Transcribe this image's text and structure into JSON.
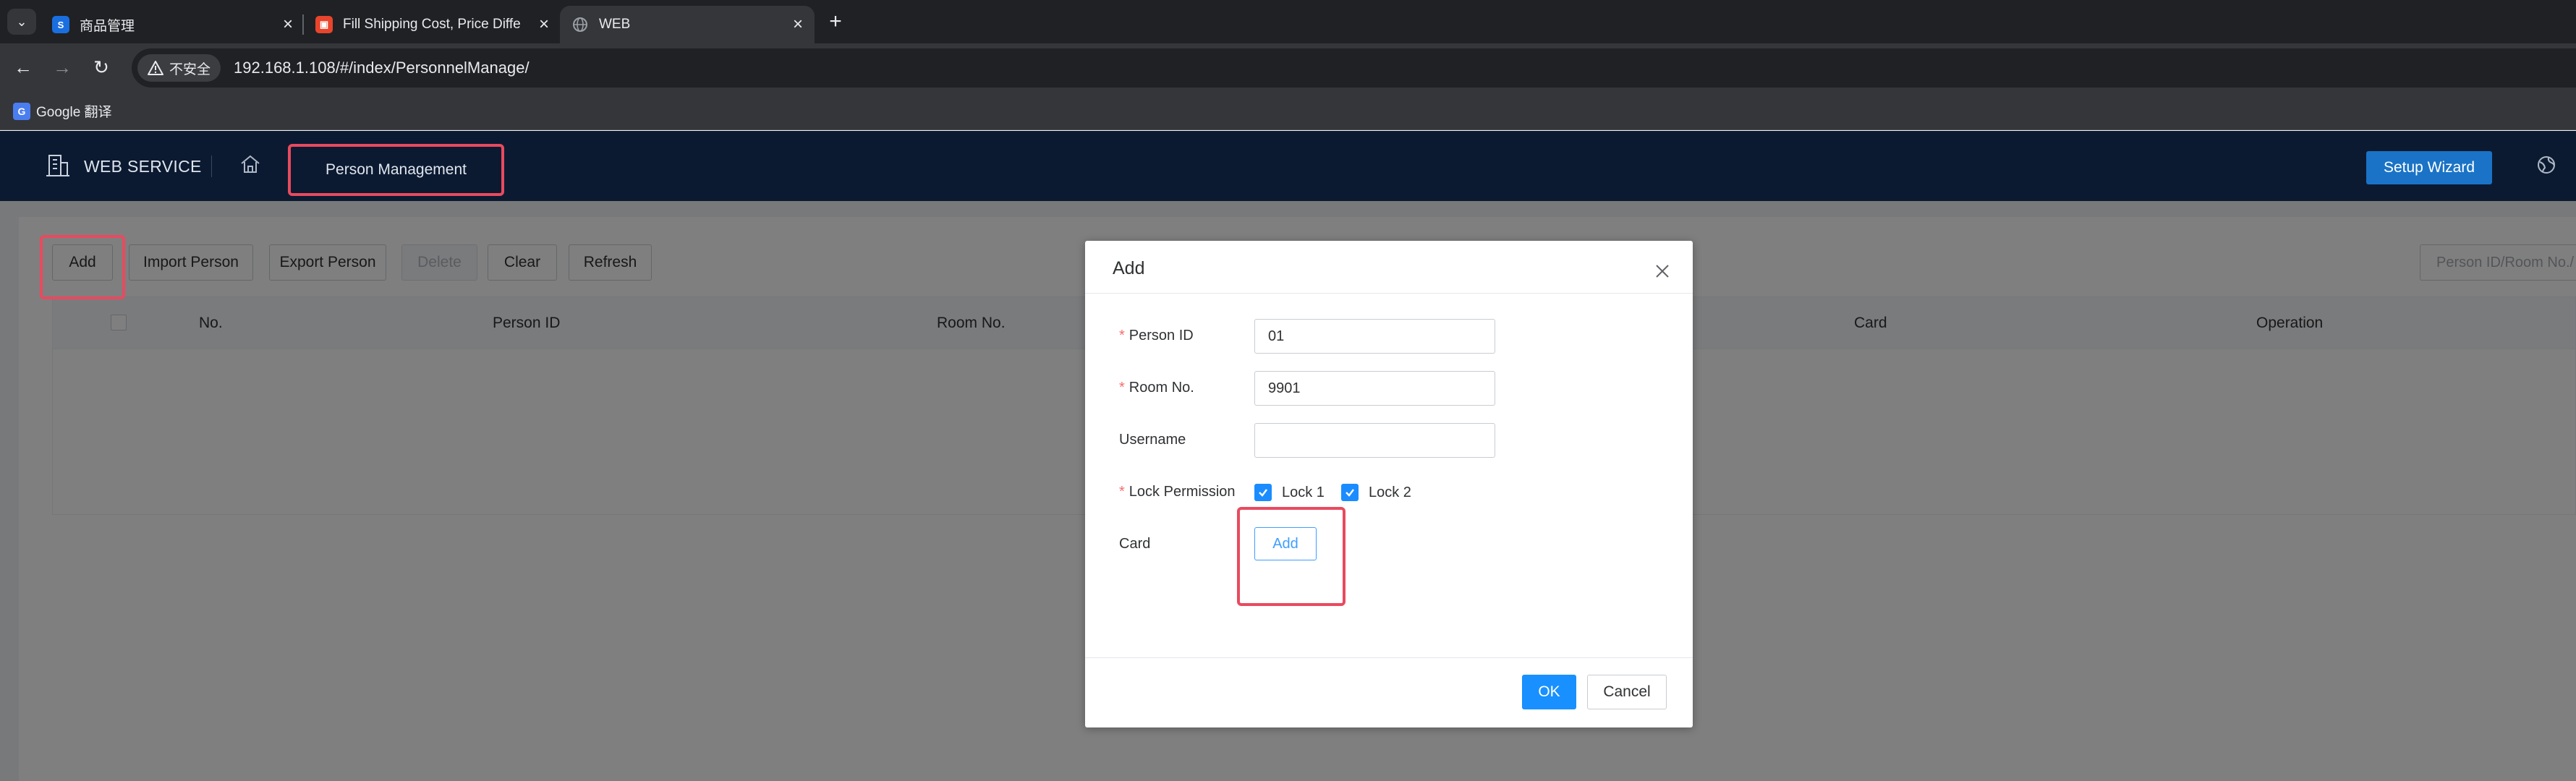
{
  "browser": {
    "tabs": [
      {
        "title": "商品管理",
        "favicon": "app-favicon",
        "active": false
      },
      {
        "title": "Fill Shipping Cost, Price Diffe",
        "favicon": "shop-favicon",
        "active": false
      },
      {
        "title": "WEB",
        "favicon": "globe-favicon",
        "active": true
      }
    ],
    "security_label": "不安全",
    "url": "192.168.1.108/#/index/PersonnelManage/",
    "bookmark": "Google 翻译"
  },
  "header": {
    "brand": "WEB SERVICE",
    "nav_active": "Person Management",
    "setup_wizard": "Setup Wizard"
  },
  "toolbar": {
    "add": "Add",
    "import": "Import Person",
    "export": "Export Person",
    "delete": "Delete",
    "clear": "Clear",
    "refresh": "Refresh",
    "search_placeholder": "Person ID/Room No./"
  },
  "table": {
    "columns": [
      "No.",
      "Person ID",
      "Room No.",
      "Card",
      "Operation"
    ],
    "rows": []
  },
  "dialog": {
    "title": "Add",
    "fields": {
      "person_id": {
        "label": "Person ID",
        "value": "01",
        "required": true
      },
      "room_no": {
        "label": "Room No.",
        "value": "9901",
        "required": true
      },
      "username": {
        "label": "Username",
        "value": "",
        "required": false
      },
      "lock_permission": {
        "label": "Lock Permission",
        "required": true
      },
      "card": {
        "label": "Card"
      }
    },
    "locks": [
      {
        "label": "Lock 1",
        "checked": true
      },
      {
        "label": "Lock 2",
        "checked": true
      }
    ],
    "required_mark": "*",
    "card_add": "Add",
    "ok": "OK",
    "cancel": "Cancel"
  },
  "colors": {
    "header_bg": "#0c1a31",
    "primary": "#1890ff",
    "highlight": "#e84a5f",
    "required": "#f56c6c"
  }
}
